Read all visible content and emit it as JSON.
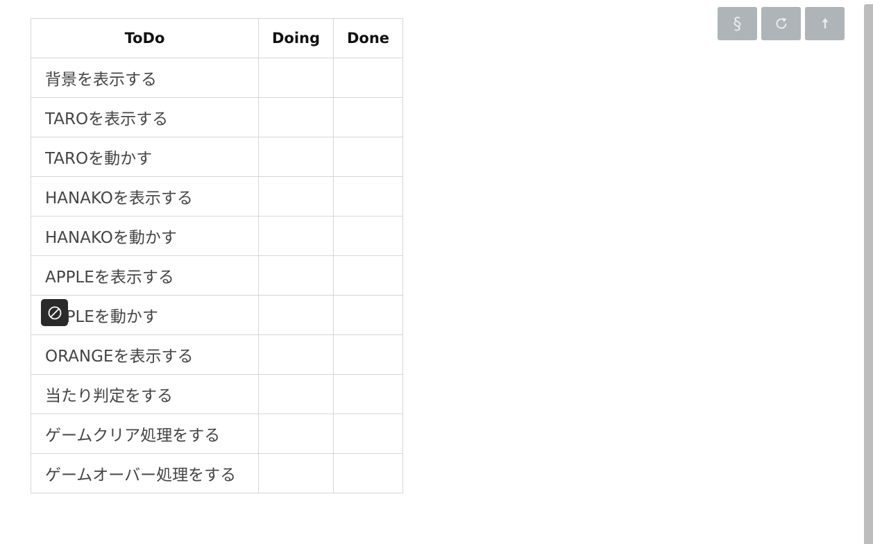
{
  "board": {
    "headers": {
      "todo": "ToDo",
      "doing": "Doing",
      "done": "Done"
    },
    "tasks": [
      "背景を表示する",
      "TAROを表示する",
      "TAROを動かす",
      "HANAKOを表示する",
      "HANAKOを動かす",
      "APPLEを表示する",
      "APPLEを動かす",
      "ORANGEを表示する",
      "当たり判定をする",
      "ゲームクリア処理をする",
      "ゲームオーバー処理をする"
    ]
  },
  "toolbar": {
    "section_glyph": "§",
    "buttons": [
      "section-icon",
      "refresh-icon",
      "upload-icon"
    ]
  },
  "badge": {
    "icon": "no-entry-icon"
  },
  "colors": {
    "toolbar_button": "#aeb4b8",
    "badge": "#2a2a2a",
    "grid": "#d6d6d6",
    "scrollbar": "#bdbdbd"
  }
}
